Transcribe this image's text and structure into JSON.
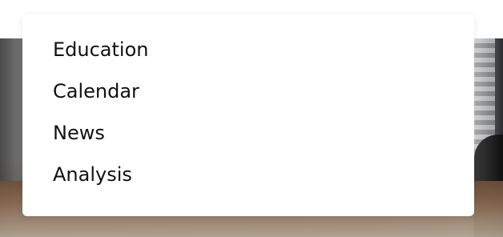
{
  "menu": {
    "items": [
      {
        "label": "Education"
      },
      {
        "label": "Calendar"
      },
      {
        "label": "News"
      },
      {
        "label": "Analysis"
      }
    ]
  },
  "colors": {
    "menu_background": "#ffffff",
    "menu_text": "#111111"
  }
}
